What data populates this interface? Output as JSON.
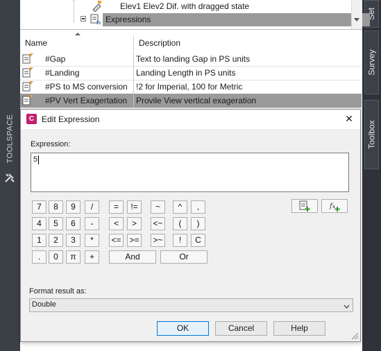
{
  "toolspace": {
    "label": "TOOLSPACE",
    "tabs": [
      "Set",
      "Survey",
      "Toolbox"
    ]
  },
  "tree": {
    "rows": [
      {
        "label": "Elev1 Elev2  Dif. with dragged state"
      },
      {
        "label": "Expressions",
        "selected": true
      }
    ]
  },
  "grid": {
    "columns": {
      "name": "Name",
      "description": "Description"
    },
    "rows": [
      {
        "name": "#Gap",
        "description": "Text to landing Gap in PS units",
        "selected": false
      },
      {
        "name": "#Landing",
        "description": "Landing Length in PS units",
        "selected": false
      },
      {
        "name": "#PS to MS conversion",
        "description": "!2 for Imperial, 100 for Metric",
        "selected": false
      },
      {
        "name": "#PV Vert Exagertation",
        "description": "Provile View vertical exageration",
        "selected": true
      }
    ]
  },
  "dialog": {
    "app_badge": "C",
    "title": "Edit Expression",
    "close_glyph": "✕",
    "expression_label": "Expression:",
    "expression_value": "5",
    "keypad": {
      "row1": [
        "7",
        "8",
        "9",
        "/"
      ],
      "row2": [
        "4",
        "5",
        "6",
        "-"
      ],
      "row3": [
        "1",
        "2",
        "3",
        "*"
      ],
      "row4": [
        ".",
        "0",
        "π",
        "+"
      ],
      "ops1": [
        "=",
        "!=",
        "~",
        "^",
        ","
      ],
      "ops2": [
        "<",
        ">",
        "<~",
        "(",
        ")"
      ],
      "ops3": [
        "<=",
        ">=",
        ">~",
        "!",
        "C"
      ],
      "logic": [
        "And",
        "Or"
      ]
    },
    "format_label": "Format result as:",
    "format_value": "Double",
    "buttons": {
      "ok": "OK",
      "cancel": "Cancel",
      "help": "Help"
    }
  }
}
